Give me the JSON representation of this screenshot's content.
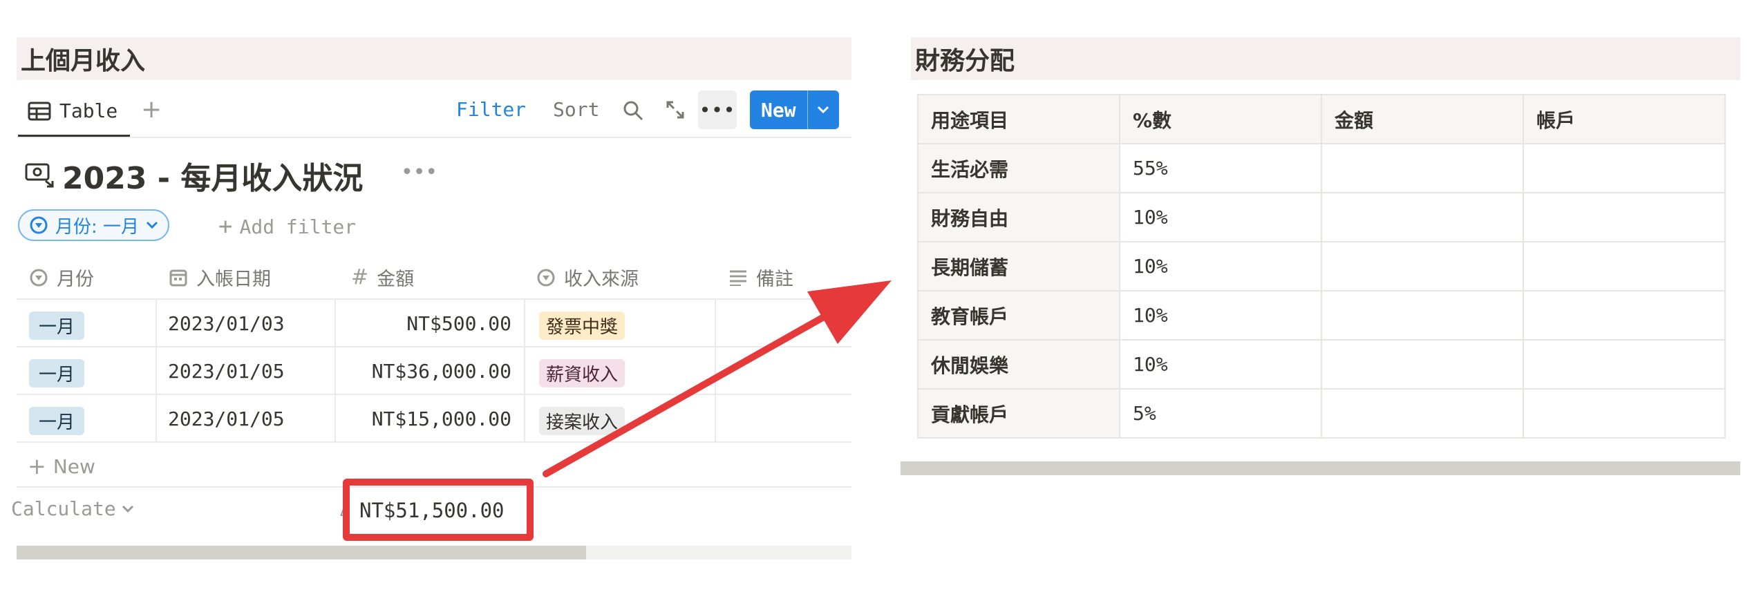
{
  "left": {
    "section_title": "上個月收入",
    "view_tab": "Table",
    "toolbar": {
      "filter": "Filter",
      "sort": "Sort",
      "new": "New"
    },
    "database_title": "2023 - 每月收入狀況",
    "filter_chip": "月份: 一月",
    "add_filter": "Add filter",
    "columns": [
      "月份",
      "入帳日期",
      "金額",
      "收入來源",
      "備註"
    ],
    "rows": [
      {
        "month": "一月",
        "date": "2023/01/03",
        "amount": "NT$500.00",
        "source": "發票中獎",
        "source_color": "#fdecc8"
      },
      {
        "month": "一月",
        "date": "2023/01/05",
        "amount": "NT$36,000.00",
        "source": "薪資收入",
        "source_color": "#f5e0e9"
      },
      {
        "month": "一月",
        "date": "2023/01/05",
        "amount": "NT$15,000.00",
        "source": "接案收入",
        "source_color": "#ececec"
      }
    ],
    "new_row": "New",
    "calculate": "Calculate",
    "sum_prefix": "Δ",
    "sum_total": "NT$51,500.00"
  },
  "right": {
    "section_title": "財務分配",
    "columns": [
      "用途項目",
      "%數",
      "金額",
      "帳戶"
    ],
    "rows": [
      {
        "item": "生活必需",
        "percent": "55%",
        "amount": "",
        "account": ""
      },
      {
        "item": "財務自由",
        "percent": "10%",
        "amount": "",
        "account": ""
      },
      {
        "item": "長期儲蓄",
        "percent": "10%",
        "amount": "",
        "account": ""
      },
      {
        "item": "教育帳戶",
        "percent": "10%",
        "amount": "",
        "account": ""
      },
      {
        "item": "休閒娛樂",
        "percent": "10%",
        "amount": "",
        "account": ""
      },
      {
        "item": "貢獻帳戶",
        "percent": "5%",
        "amount": "",
        "account": ""
      }
    ]
  },
  "colors": {
    "accent": "#2383e2",
    "highlight_red": "#e5393a",
    "header_bg": "#f5efee"
  }
}
